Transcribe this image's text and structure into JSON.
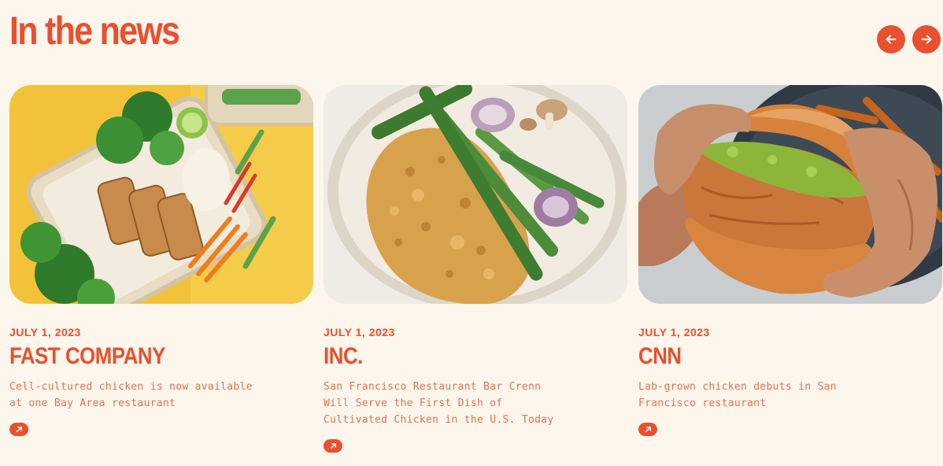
{
  "section": {
    "title": "In the news"
  },
  "nav": {
    "prev_icon": "arrow-left-icon",
    "next_icon": "arrow-right-icon"
  },
  "colors": {
    "accent": "#e8502f",
    "background": "#fdf6ec",
    "body_text": "#e2724f"
  },
  "articles": [
    {
      "date": "JULY 1, 2023",
      "outlet": "FAST COMPANY",
      "headline": "Cell-cultured chicken is now available at one Bay Area restaurant",
      "image": "bowl-with-chicken-herbs-and-vegetables-on-yellow",
      "link_icon": "external-arrow-icon"
    },
    {
      "date": "JULY 1, 2023",
      "outlet": "INC.",
      "headline": "San Francisco Restaurant Bar Crenn Will Serve the First Dish of Cultivated Chicken in the U.S. Today",
      "image": "plate-of-breaded-chicken-with-asparagus",
      "link_icon": "external-arrow-icon"
    },
    {
      "date": "JULY 1, 2023",
      "outlet": "CNN",
      "headline": "Lab-grown chicken debuts in San Francisco restaurant",
      "image": "hands-holding-chicken-sandwich",
      "link_icon": "external-arrow-icon"
    }
  ]
}
